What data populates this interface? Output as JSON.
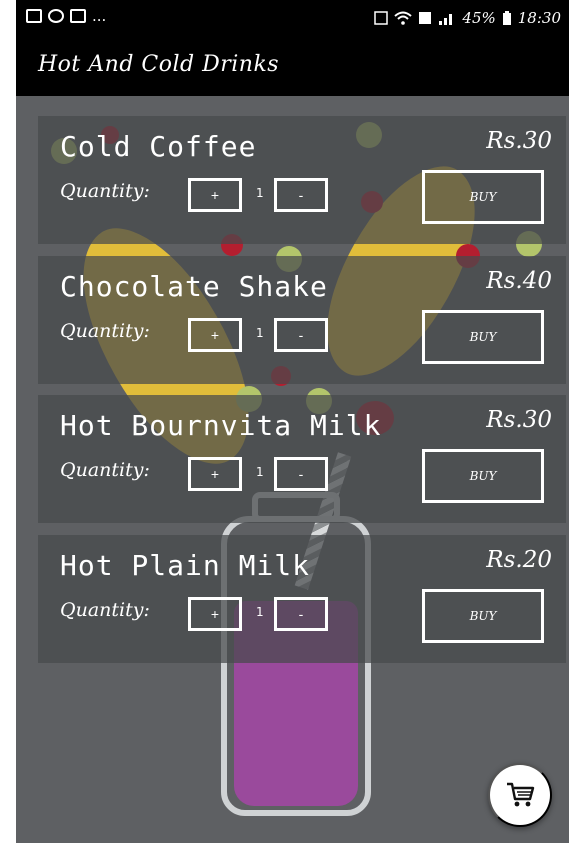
{
  "status_bar": {
    "left_more": "...",
    "battery": "45%",
    "time": "18:30"
  },
  "app_bar": {
    "title": "Hot And Cold Drinks"
  },
  "drinks": [
    {
      "name": "Cold Coffee",
      "price": "Rs.30",
      "quantity_label": "Quantity:",
      "plus_label": "+",
      "minus_label": "-",
      "quantity_value": "1",
      "buy_label": "BUY"
    },
    {
      "name": "Chocolate Shake",
      "price": "Rs.40",
      "quantity_label": "Quantity:",
      "plus_label": "+",
      "minus_label": "-",
      "quantity_value": "1",
      "buy_label": "BUY"
    },
    {
      "name": "Hot Bournvita Milk",
      "price": "Rs.30",
      "quantity_label": "Quantity:",
      "plus_label": "+",
      "minus_label": "-",
      "quantity_value": "1",
      "buy_label": "BUY"
    },
    {
      "name": "Hot Plain Milk",
      "price": "Rs.20",
      "quantity_label": "Quantity:",
      "plus_label": "+",
      "minus_label": "-",
      "quantity_value": "1",
      "buy_label": "BUY"
    }
  ],
  "icons": {
    "cart": "shopping-cart-icon",
    "status": [
      "image-icon",
      "app-icon",
      "mail-icon",
      "volte-icon",
      "wifi-icon",
      "sim-icon",
      "signal-icon",
      "battery-icon"
    ]
  },
  "colors": {
    "bar_background": "#000000",
    "card_overlay": "#46494c",
    "text": "#ffffff",
    "cart_fab": "#ffffff"
  }
}
